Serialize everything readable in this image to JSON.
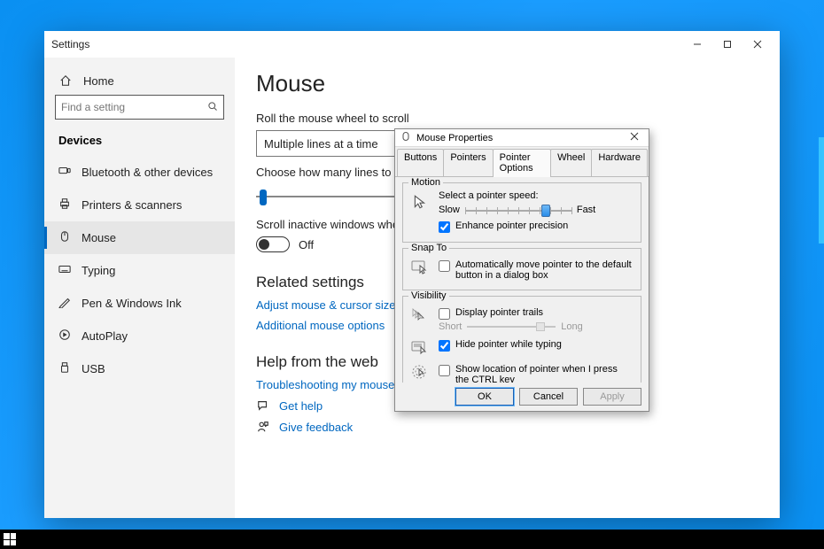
{
  "window": {
    "title": "Settings"
  },
  "sidebar": {
    "home": "Home",
    "search_placeholder": "Find a setting",
    "section": "Devices",
    "items": [
      {
        "label": "Bluetooth & other devices"
      },
      {
        "label": "Printers & scanners"
      },
      {
        "label": "Mouse"
      },
      {
        "label": "Typing"
      },
      {
        "label": "Pen & Windows Ink"
      },
      {
        "label": "AutoPlay"
      },
      {
        "label": "USB"
      }
    ]
  },
  "content": {
    "page_title": "Mouse",
    "scroll_label": "Roll the mouse wheel to scroll",
    "scroll_value": "Multiple lines at a time",
    "lines_label": "Choose how many lines to scroll each time",
    "inactive_label": "Scroll inactive windows when I hover over them",
    "toggle_state": "Off",
    "related_heading": "Related settings",
    "link_adjust": "Adjust mouse & cursor size",
    "link_additional": "Additional mouse options",
    "help_heading": "Help from the web",
    "link_troubleshoot": "Troubleshooting my mouse",
    "link_gethelp": "Get help",
    "link_feedback": "Give feedback"
  },
  "dialog": {
    "title": "Mouse Properties",
    "tabs": {
      "buttons": "Buttons",
      "pointers": "Pointers",
      "pointer_options": "Pointer Options",
      "wheel": "Wheel",
      "hardware": "Hardware"
    },
    "motion": {
      "group": "Motion",
      "label": "Select a pointer speed:",
      "slow": "Slow",
      "fast": "Fast",
      "enhance": "Enhance pointer precision",
      "enhance_checked": true,
      "speed_position_pct": 72
    },
    "snap": {
      "group": "Snap To",
      "label": "Automatically move pointer to the default button in a dialog box",
      "checked": false
    },
    "visibility": {
      "group": "Visibility",
      "trails_label": "Display pointer trails",
      "trails_checked": false,
      "short": "Short",
      "long": "Long",
      "hide_label": "Hide pointer while typing",
      "hide_checked": true,
      "ctrl_label": "Show location of pointer when I press the CTRL key",
      "ctrl_checked": false
    },
    "buttons": {
      "ok": "OK",
      "cancel": "Cancel",
      "apply": "Apply"
    }
  }
}
